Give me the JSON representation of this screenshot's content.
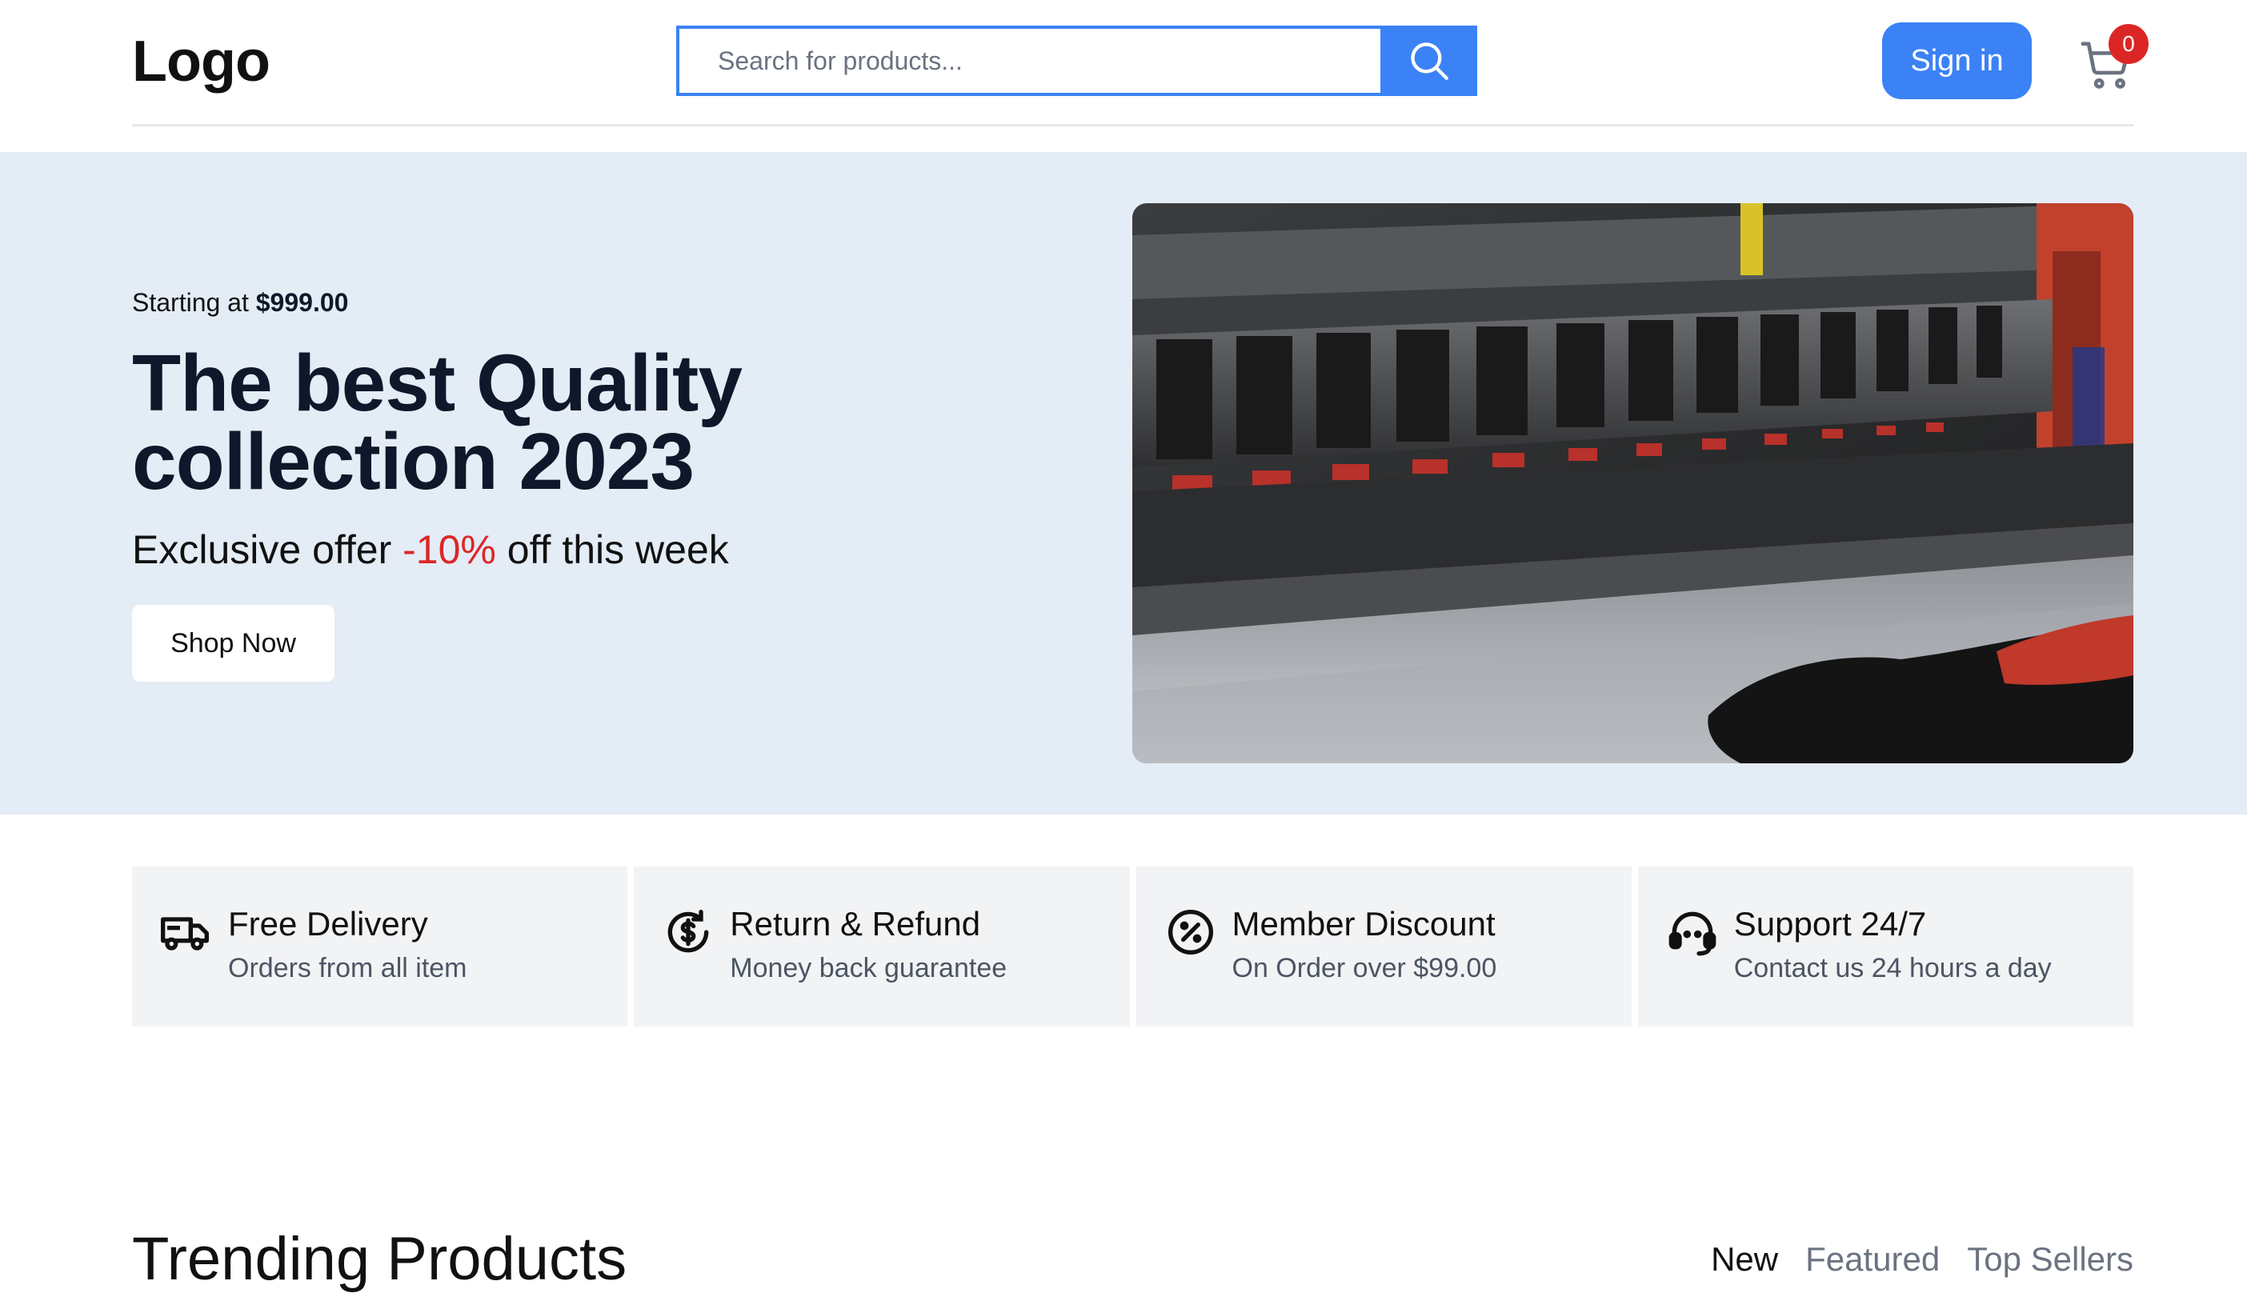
{
  "header": {
    "logo": "Logo",
    "search_placeholder": "Search for products...",
    "signin_label": "Sign in",
    "cart_count": "0"
  },
  "hero": {
    "pre_label": "Starting at",
    "pre_price": "$999.00",
    "title": "The best Quality collection 2023",
    "sub_before": "Exclusive offer",
    "sub_discount": "-10%",
    "sub_after": "off this week",
    "shop_label": "Shop Now"
  },
  "features": [
    {
      "icon": "delivery-truck-icon",
      "title": "Free Delivery",
      "desc": "Orders from all item"
    },
    {
      "icon": "refund-icon",
      "title": "Return & Refund",
      "desc": "Money back guarantee"
    },
    {
      "icon": "discount-icon",
      "title": "Member Discount",
      "desc": "On Order over $99.00"
    },
    {
      "icon": "headset-icon",
      "title": "Support 24/7",
      "desc": "Contact us 24 hours a day"
    }
  ],
  "trending": {
    "title": "Trending Products",
    "tabs": [
      "New",
      "Featured",
      "Top Sellers"
    ]
  },
  "colors": {
    "accent": "#3b82f6",
    "hero_bg": "#e4ecf5",
    "badge": "#dc2626",
    "discount": "#dc2626"
  }
}
